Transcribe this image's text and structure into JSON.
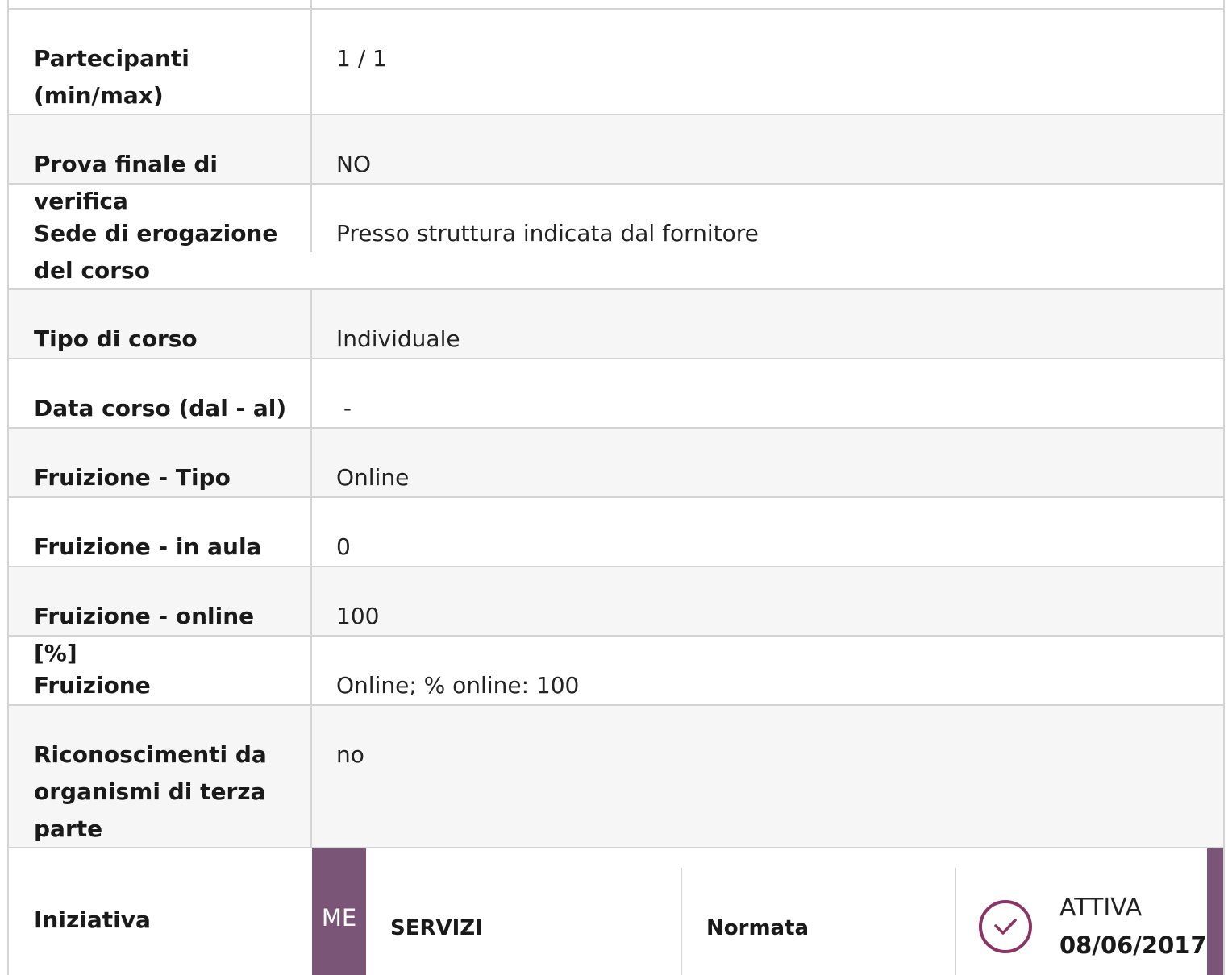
{
  "rows": [
    {
      "label": "Partecipanti (min/max)",
      "value": "1 / 1"
    },
    {
      "label": "Prova finale di verifica",
      "value": "NO"
    },
    {
      "label": "Sede di erogazione del corso",
      "value": "Presso struttura indicata dal fornitore"
    },
    {
      "label": "Tipo di corso",
      "value": "Individuale"
    },
    {
      "label": "Data corso (dal - al)",
      "value": " -"
    },
    {
      "label": "Fruizione - Tipo",
      "value": "Online"
    },
    {
      "label": "Fruizione - in aula [%]",
      "value": "0"
    },
    {
      "label": "Fruizione - online [%]",
      "value": "100"
    },
    {
      "label": "Fruizione",
      "value": "Online; % online: 100"
    },
    {
      "label": "Riconoscimenti da organismi di terza parte",
      "value": "no"
    }
  ],
  "iniziativa": {
    "label": "Iniziativa",
    "badge": "ME",
    "category": "SERVIZI",
    "type": "Normata",
    "status": "ATTIVA",
    "date": "08/06/2017",
    "status_icon": "check-circle-icon",
    "accent_color": "#7b5577",
    "icon_color": "#8a3566"
  }
}
